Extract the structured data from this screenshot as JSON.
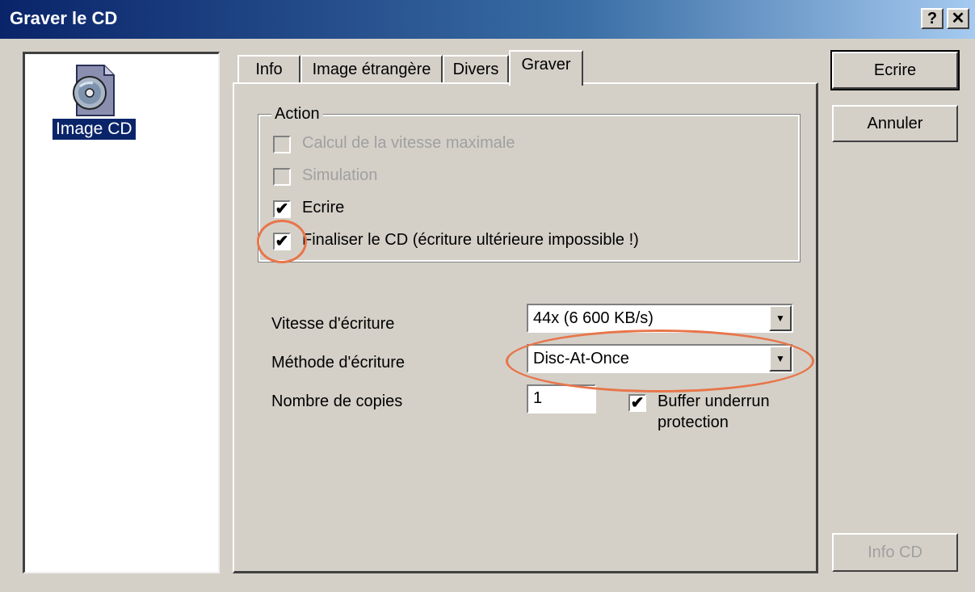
{
  "window": {
    "title": "Graver le CD",
    "help_button": "?",
    "close_button": "✕"
  },
  "left_pane": {
    "item_label": "Image CD"
  },
  "tabs": [
    {
      "label": "Info"
    },
    {
      "label": "Image étrangère"
    },
    {
      "label": "Divers"
    },
    {
      "label": "Graver"
    }
  ],
  "action_group": {
    "label": "Action",
    "options": [
      {
        "label": "Calcul de la vitesse maximale",
        "checked": false,
        "enabled": false
      },
      {
        "label": "Simulation",
        "checked": false,
        "enabled": false
      },
      {
        "label": "Ecrire",
        "checked": true,
        "enabled": true
      },
      {
        "label": "Finaliser le CD (écriture ultérieure impossible !)",
        "checked": true,
        "enabled": true
      }
    ]
  },
  "fields": {
    "speed_label": "Vitesse d'écriture",
    "speed_value": "44x (6 600 KB/s)",
    "method_label": "Méthode d'écriture",
    "method_value": "Disc-At-Once",
    "copies_label": "Nombre de copies",
    "copies_value": "1",
    "buffer_label_line1": "Buffer underrun",
    "buffer_label_line2": "protection",
    "buffer_checked": true
  },
  "buttons": {
    "write": "Ecrire",
    "cancel": "Annuler",
    "info_cd": "Info CD"
  },
  "annotation_color": "#e8754a"
}
